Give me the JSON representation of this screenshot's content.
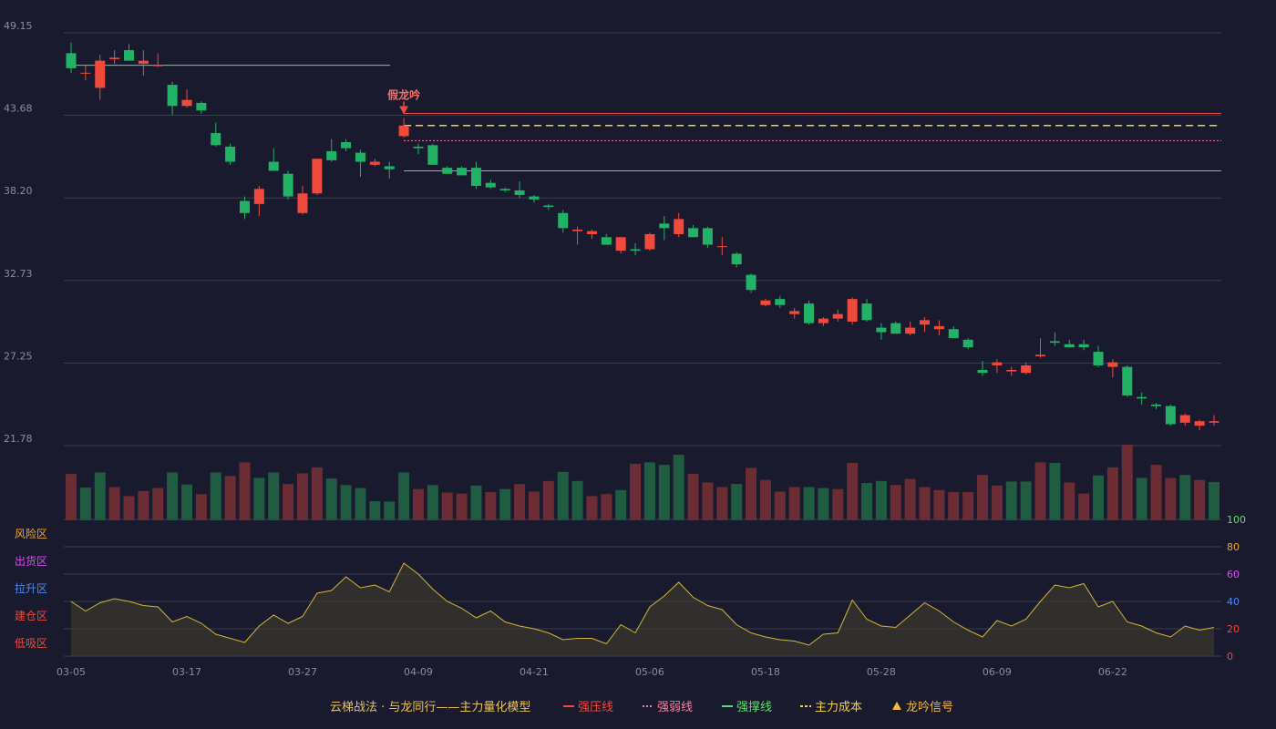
{
  "chart_data": [
    {
      "type": "candlestick",
      "y_ticks": [
        "49.15",
        "43.68",
        "38.20",
        "32.73",
        "27.25",
        "21.78"
      ],
      "ylim": [
        21.78,
        49.15
      ],
      "x_ticks": [
        "03-05",
        "03-17",
        "03-27",
        "04-09",
        "04-21",
        "05-06",
        "05-18",
        "05-28",
        "06-09",
        "06-22"
      ],
      "x_tick_indices": [
        0,
        8,
        16,
        24,
        32,
        40,
        48,
        56,
        64,
        72
      ],
      "colors": {
        "up": "#ef4a3c",
        "down": "#22b266"
      },
      "ohlc": [
        [
          47.8,
          48.5,
          46.5,
          46.8
        ],
        [
          46.5,
          47.0,
          46.0,
          46.5
        ],
        [
          45.5,
          47.7,
          44.7,
          47.3
        ],
        [
          47.4,
          48.0,
          47.1,
          47.5
        ],
        [
          48.0,
          48.4,
          47.5,
          47.3
        ],
        [
          47.1,
          48.0,
          46.3,
          47.3
        ],
        [
          47.0,
          47.8,
          46.9,
          47.0
        ],
        [
          45.7,
          45.9,
          43.7,
          44.3
        ],
        [
          44.3,
          45.4,
          44.2,
          44.7
        ],
        [
          44.5,
          44.6,
          43.8,
          44.0
        ],
        [
          42.5,
          43.2,
          41.6,
          41.7
        ],
        [
          41.6,
          41.8,
          40.4,
          40.6
        ],
        [
          38.0,
          38.3,
          36.8,
          37.2
        ],
        [
          37.8,
          39.0,
          37.0,
          38.8
        ],
        [
          40.6,
          41.5,
          40.3,
          40.0
        ],
        [
          39.8,
          40.0,
          38.1,
          38.3
        ],
        [
          37.2,
          39.0,
          37.1,
          38.5
        ],
        [
          38.5,
          40.8,
          38.4,
          40.8
        ],
        [
          41.3,
          42.1,
          40.6,
          40.7
        ],
        [
          41.9,
          42.1,
          41.3,
          41.5
        ],
        [
          41.2,
          41.4,
          39.6,
          40.6
        ],
        [
          40.4,
          40.8,
          40.3,
          40.6
        ],
        [
          40.3,
          40.6,
          39.5,
          40.1
        ],
        [
          42.3,
          43.5,
          42.2,
          43.0
        ],
        [
          41.6,
          41.8,
          41.1,
          41.5
        ],
        [
          41.7,
          41.8,
          40.4,
          40.4
        ],
        [
          40.2,
          40.3,
          39.9,
          39.8
        ],
        [
          40.2,
          40.3,
          39.7,
          39.7
        ],
        [
          40.2,
          40.6,
          38.8,
          39.0
        ],
        [
          39.2,
          39.4,
          38.8,
          38.9
        ],
        [
          38.8,
          38.9,
          38.6,
          38.7
        ],
        [
          38.7,
          39.3,
          38.2,
          38.4
        ],
        [
          38.3,
          38.4,
          37.9,
          38.1
        ],
        [
          37.7,
          37.8,
          37.4,
          37.6
        ],
        [
          37.2,
          37.4,
          35.9,
          36.2
        ],
        [
          36.0,
          36.3,
          35.1,
          36.1
        ],
        [
          35.8,
          36.1,
          35.5,
          36.0
        ],
        [
          35.6,
          35.8,
          35.1,
          35.1
        ],
        [
          34.7,
          35.6,
          34.5,
          35.6
        ],
        [
          34.8,
          35.2,
          34.4,
          34.7
        ],
        [
          34.8,
          35.9,
          34.7,
          35.8
        ],
        [
          36.5,
          37.0,
          35.4,
          36.2
        ],
        [
          35.8,
          37.2,
          35.6,
          36.8
        ],
        [
          36.2,
          36.4,
          35.6,
          35.6
        ],
        [
          36.2,
          36.3,
          34.9,
          35.1
        ],
        [
          35.0,
          35.6,
          34.4,
          35.0
        ],
        [
          34.5,
          34.6,
          33.6,
          33.8
        ],
        [
          33.1,
          33.2,
          31.9,
          32.1
        ],
        [
          31.1,
          31.5,
          31.0,
          31.4
        ],
        [
          31.5,
          31.7,
          30.9,
          31.1
        ],
        [
          30.5,
          30.9,
          30.2,
          30.7
        ],
        [
          31.2,
          31.4,
          29.8,
          29.9
        ],
        [
          29.9,
          30.3,
          29.7,
          30.2
        ],
        [
          30.2,
          30.8,
          30.0,
          30.5
        ],
        [
          30.0,
          31.6,
          29.8,
          31.5
        ],
        [
          31.2,
          31.5,
          30.0,
          30.1
        ],
        [
          29.6,
          29.9,
          28.8,
          29.3
        ],
        [
          29.9,
          30.0,
          29.2,
          29.2
        ],
        [
          29.2,
          30.0,
          29.1,
          29.6
        ],
        [
          29.8,
          30.3,
          29.3,
          30.1
        ],
        [
          29.5,
          30.1,
          29.1,
          29.7
        ],
        [
          29.5,
          29.7,
          28.9,
          28.9
        ],
        [
          28.8,
          28.9,
          28.2,
          28.3
        ],
        [
          26.8,
          27.4,
          26.4,
          26.6
        ],
        [
          27.1,
          27.5,
          26.6,
          27.3
        ],
        [
          26.7,
          27.0,
          26.4,
          26.8
        ],
        [
          26.6,
          27.3,
          26.5,
          27.1
        ],
        [
          27.7,
          28.9,
          27.6,
          27.8
        ],
        [
          28.7,
          29.3,
          28.4,
          28.6
        ],
        [
          28.5,
          28.8,
          28.3,
          28.3
        ],
        [
          28.5,
          28.8,
          28.1,
          28.3
        ],
        [
          28.0,
          28.4,
          27.0,
          27.1
        ],
        [
          27.0,
          27.5,
          26.3,
          27.3
        ],
        [
          27.0,
          27.1,
          25.0,
          25.1
        ],
        [
          25.0,
          25.3,
          24.5,
          24.9
        ],
        [
          24.5,
          24.6,
          24.2,
          24.4
        ],
        [
          24.4,
          24.5,
          23.1,
          23.2
        ],
        [
          23.3,
          23.9,
          23.1,
          23.8
        ],
        [
          23.1,
          23.5,
          22.8,
          23.4
        ],
        [
          23.3,
          23.8,
          23.1,
          23.4
        ]
      ],
      "volume": [
        92,
        65,
        95,
        66,
        48,
        58,
        64,
        95,
        71,
        52,
        95,
        88,
        115,
        84,
        95,
        72,
        93,
        105,
        83,
        70,
        64,
        38,
        37,
        95,
        62,
        70,
        55,
        53,
        69,
        56,
        62,
        72,
        57,
        78,
        96,
        78,
        48,
        52,
        60,
        112,
        115,
        110,
        130,
        92,
        75,
        66,
        72,
        104,
        80,
        57,
        66,
        66,
        64,
        62,
        114,
        74,
        78,
        70,
        82,
        66,
        60,
        56,
        56,
        90,
        69,
        77,
        77,
        115,
        114,
        75,
        53,
        89,
        105,
        150,
        84,
        110,
        84,
        90,
        80,
        76
      ],
      "volume_up": [
        true,
        false,
        false,
        true,
        true,
        true,
        true,
        false,
        false,
        true,
        false,
        true,
        true,
        false,
        false,
        true,
        true,
        true,
        false,
        false,
        false,
        false,
        false,
        false,
        true,
        false,
        true,
        true,
        false,
        true,
        false,
        true,
        true,
        true,
        false,
        false,
        true,
        true,
        false,
        true,
        false,
        false,
        false,
        true,
        true,
        true,
        false,
        true,
        true,
        true,
        true,
        false,
        false,
        true,
        true,
        false,
        false,
        true,
        true,
        true,
        true,
        true,
        true,
        true,
        true,
        false,
        false,
        true,
        false,
        true,
        true,
        false,
        true,
        true,
        false,
        true,
        true,
        false,
        true,
        false
      ]
    },
    {
      "type": "line",
      "y_ticks": [
        "100",
        "80",
        "60",
        "40",
        "20",
        "0"
      ],
      "ylim": [
        0,
        100
      ],
      "zones": [
        "风险区",
        "出货区",
        "拉升区",
        "建仓区",
        "低吸区"
      ],
      "values": [
        40,
        33,
        39,
        42,
        40,
        37,
        36,
        25,
        29,
        24,
        16,
        13,
        10,
        22,
        30,
        24,
        29,
        46,
        48,
        58,
        50,
        52,
        47,
        68,
        60,
        49,
        40,
        35,
        28,
        33,
        25,
        22,
        20,
        17,
        12,
        13,
        13,
        9,
        23,
        17,
        36,
        44,
        54,
        43,
        37,
        34,
        23,
        17,
        14,
        12,
        11,
        8,
        16,
        17,
        41,
        27,
        22,
        21,
        30,
        39,
        33,
        25,
        19,
        14,
        26,
        22,
        27,
        40,
        52,
        50,
        53,
        36,
        40,
        25,
        22,
        17,
        14,
        22,
        19,
        21
      ]
    }
  ],
  "annotations": {
    "signal_label": "假龙吟"
  },
  "levels": {
    "strong_pressure": 43.8,
    "main_cost": 43.0,
    "strong_weak": 42.0,
    "strong_support": 40.0,
    "early_support": 47.0
  },
  "legend": {
    "title": "云梯战法 · 与龙同行——主力量化模型",
    "items": [
      {
        "label": "强压线",
        "color": "#ef4a3c",
        "style": "solid"
      },
      {
        "label": "强弱线",
        "color": "#f87fa0",
        "style": "dotted"
      },
      {
        "label": "强撑线",
        "color": "#5ddc6d",
        "style": "solid"
      },
      {
        "label": "主力成本",
        "color": "#f5d142",
        "style": "dashed"
      },
      {
        "label": "龙吟信号",
        "color": "#f5b942",
        "style": "triangle"
      }
    ]
  },
  "colors": {
    "background": "#1a1a2e",
    "grid": "#3a3d4e",
    "oscillator_line": "#d4b534",
    "zone_risk": "#f5a623",
    "zone_distribute": "#d84bf0",
    "zone_pull": "#4c8cf5",
    "zone_build": "#ef4a3c",
    "zone_low": "#ef4a3c"
  }
}
